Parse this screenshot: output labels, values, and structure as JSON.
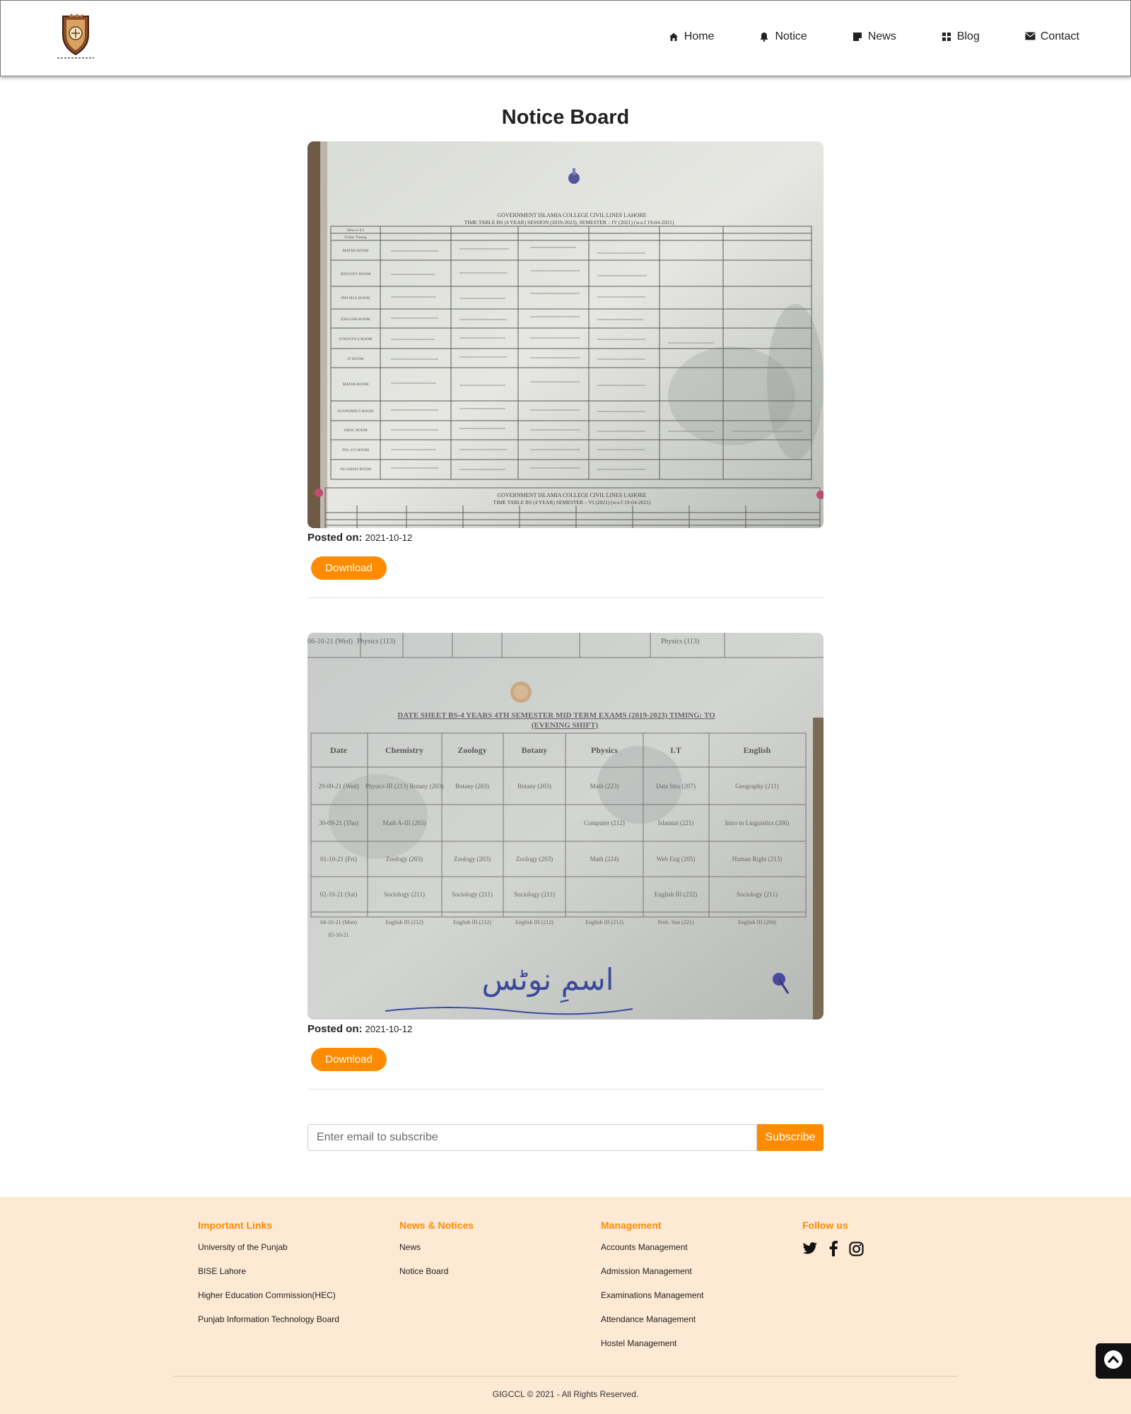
{
  "header": {
    "logo_alt": "GIGCCL crest",
    "nav": [
      {
        "label": "Home",
        "icon": "home-icon"
      },
      {
        "label": "Notice",
        "icon": "bell-icon"
      },
      {
        "label": "News",
        "icon": "note-icon"
      },
      {
        "label": "Blog",
        "icon": "grid-icon"
      },
      {
        "label": "Contact",
        "icon": "envelope-icon"
      }
    ]
  },
  "main": {
    "title": "Notice Board",
    "notices": [
      {
        "posted_label": "Posted on:",
        "date": "2021-10-12",
        "download_label": "Download",
        "image_heading_1": "GOVERNMENT ISLAMIA COLLEGE CIVIL LINES LAHORE",
        "image_heading_2": "TIME TABLE BS (4 YEAR) SESSION (2019-2023), SEMESTER – IV (2021) (w.e.f 19-04-2021)",
        "image_heading_3": "GOVERNMENT ISLAMIA COLLEGE CIVIL LINES LAHORE",
        "image_heading_4": "TIME TABLE BS (4 YEAR) SEMESTER – VI (2021) (w.e.f 19-04-2021)",
        "row_labels": [
          "Mon to Fri",
          "Friday Timing",
          "MATHS ROOM",
          "BIOLOGY ROOM",
          "PHYSICS ROOM",
          "ENGLISH ROOM",
          "STATISTICS ROOM",
          "IT ROOM",
          "MATHS ROOM",
          "ECONOMICS ROOM",
          "URDU ROOM",
          "POL SCI ROOM",
          "ISLAMIAT ROOM"
        ]
      },
      {
        "posted_label": "Posted on:",
        "date": "2021-10-12",
        "download_label": "Download",
        "top_row": [
          "06-10-21 (Wed)",
          "Physics (113)",
          "Physics (113)"
        ],
        "sheet_title_1": "DATE SHEET BS-4 YEARS 4TH SEMESTER MID TERM EXAMS (2019-2023) TIMING:       TO",
        "sheet_title_2": "(EVENING SHIFT)",
        "columns": [
          "Date",
          "Chemistry",
          "Zoology",
          "Botany",
          "Physics",
          "I.T",
          "English"
        ],
        "rows": [
          [
            "29-09-21 (Wed)",
            "Physics III (213) Botany (203)",
            "Botany (203)",
            "Botany (203)",
            "Math (223)",
            "Data Stru (207)",
            "Geography (211)"
          ],
          [
            "30-09-21 (Thu)",
            "Math A-III (203)",
            "",
            "",
            "Computer (212)",
            "Islamiat (221)",
            "Intro to Linguistics (206)"
          ],
          [
            "01-10-21 (Fri)",
            "Zoology (203)",
            "Zoology (203)",
            "Zoology (203)",
            "Math (224)",
            "Web Eng (205)",
            "Human Right (213)"
          ],
          [
            "02-10-21 (Sat)",
            "Sociology (211)",
            "Sociology (211)",
            "Sociology (211)",
            "",
            "English III (232)",
            "Sociology (211)"
          ],
          [
            "04-10-21 (Mon)",
            "English III (212)",
            "English III (212)",
            "English III (212)",
            "English III (212)",
            "Prob. Stat (221)",
            "English III (204)"
          ],
          [
            "05-10-21",
            "",
            "",
            "",
            "",
            "",
            ""
          ]
        ],
        "handwriting": "اسمِ نوٹس"
      }
    ]
  },
  "subscribe": {
    "placeholder": "Enter email to subscribe",
    "button_label": "Subscribe"
  },
  "footer": {
    "columns": [
      {
        "heading": "Important Links",
        "links": [
          "University of the Punjab",
          "BISE Lahore",
          "Higher Education Commission(HEC)",
          "Punjab Information Technology Board"
        ]
      },
      {
        "heading": "News & Notices",
        "links": [
          "News",
          "Notice Board"
        ]
      },
      {
        "heading": "Management",
        "links": [
          "Accounts Management",
          "Admission Management",
          "Examinations Management",
          "Attendance Management",
          "Hostel Management"
        ]
      },
      {
        "heading": "Follow us",
        "social": [
          "twitter-icon",
          "facebook-icon",
          "instagram-icon"
        ]
      }
    ],
    "copyright": "GIGCCL © 2021 - All Rights Reserved."
  },
  "colors": {
    "accent": "#ff8b00",
    "footer_bg": "#fde9d4",
    "text": "#222222"
  }
}
